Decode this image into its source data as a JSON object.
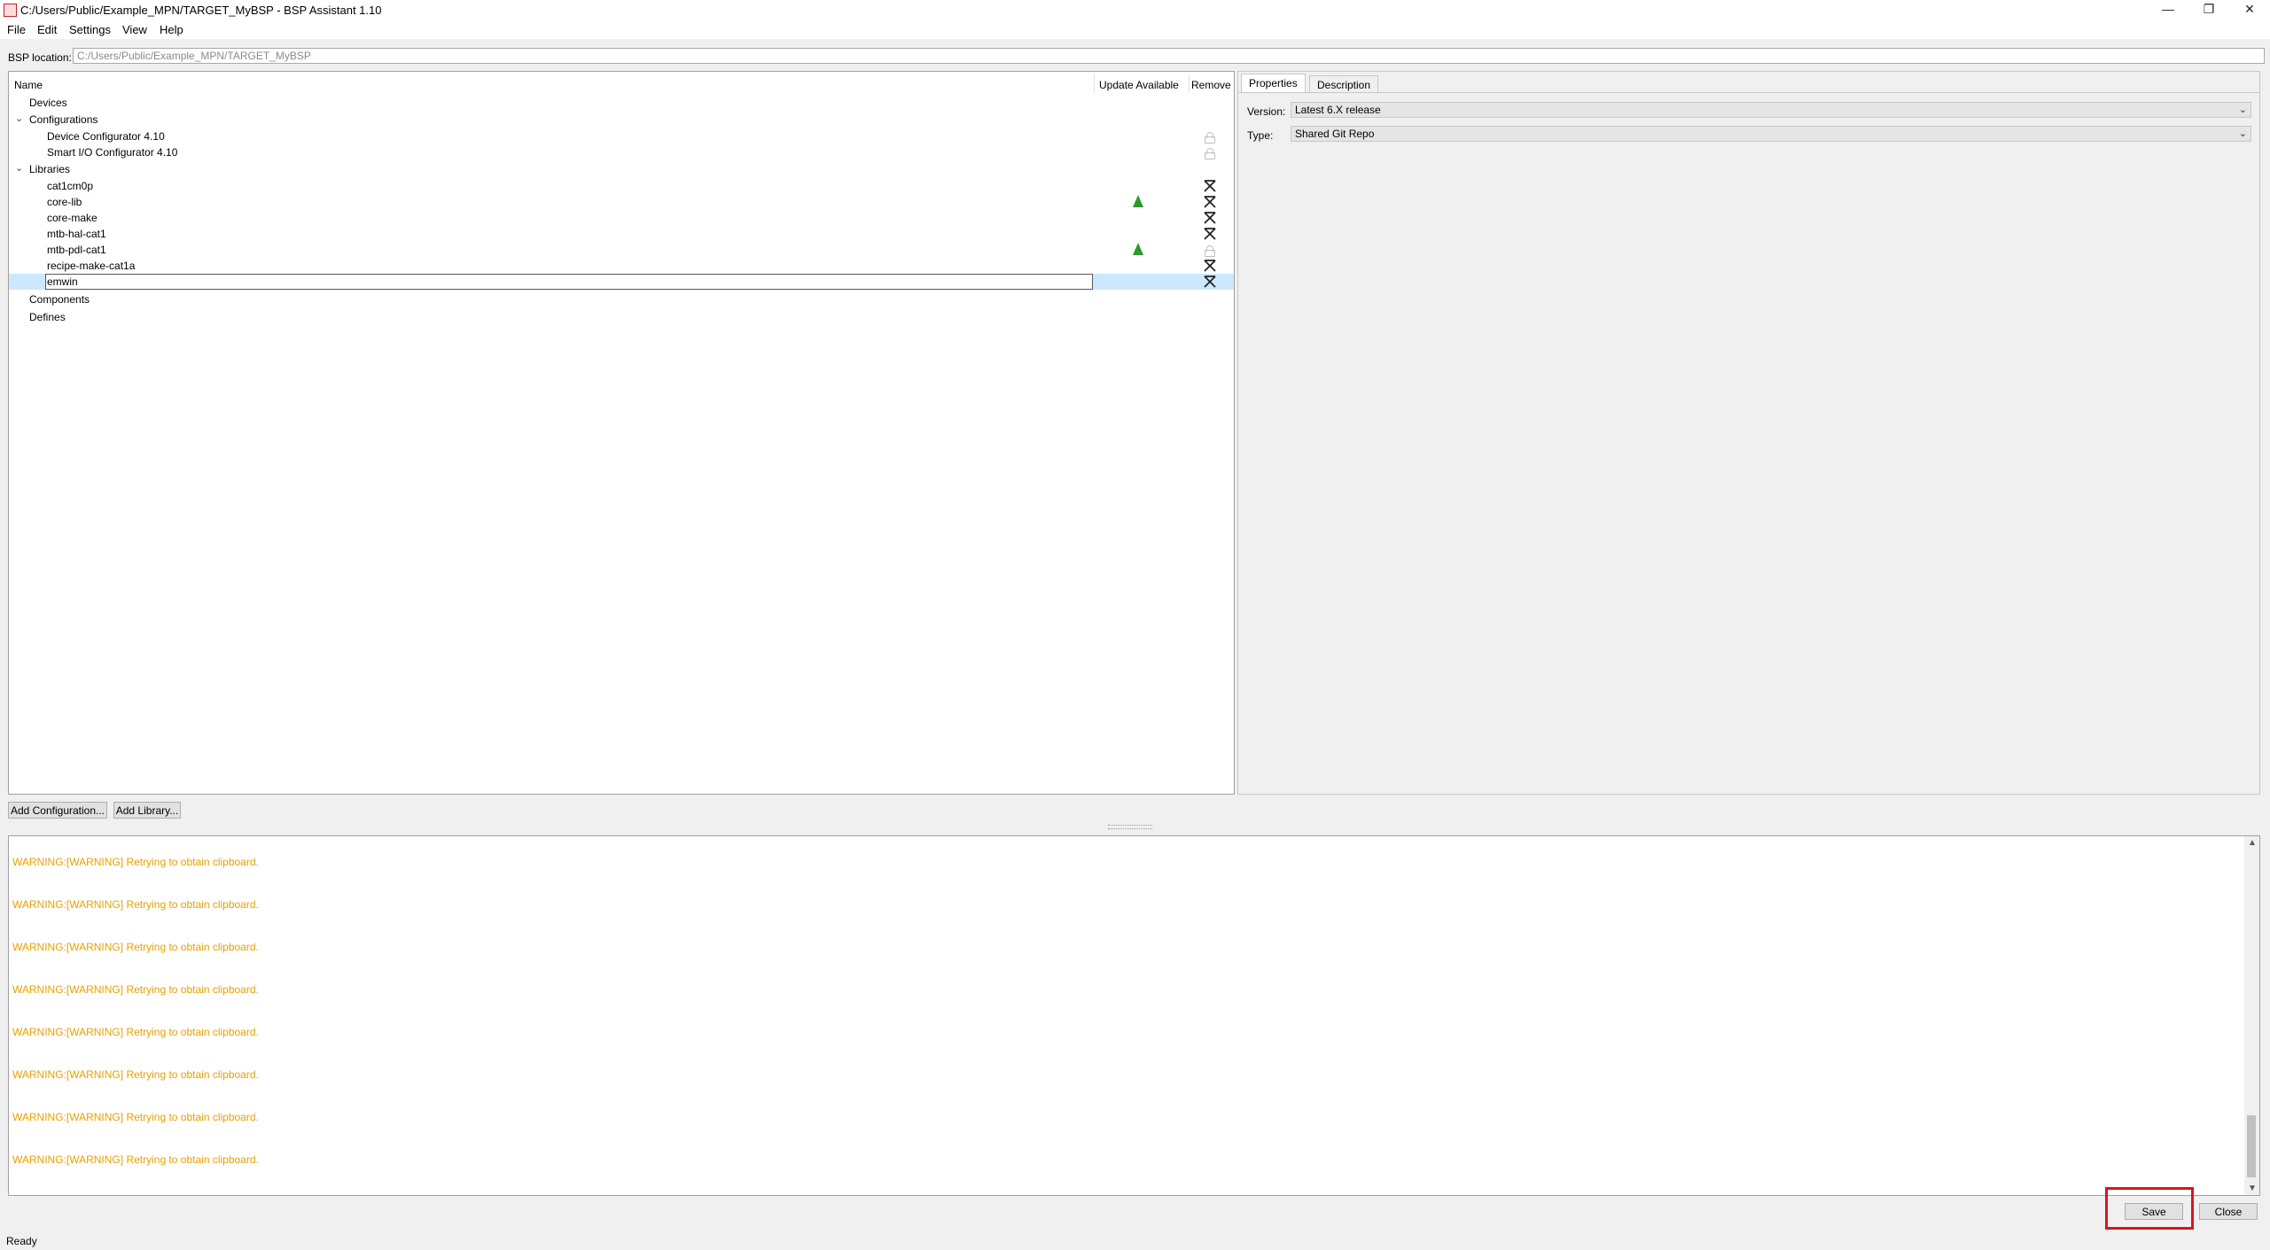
{
  "window": {
    "title": "C:/Users/Public/Example_MPN/TARGET_MyBSP - BSP Assistant 1.10",
    "minimize": "—",
    "restore": "❐",
    "close": "✕"
  },
  "menu": [
    "File",
    "Edit",
    "Settings",
    "View",
    "Help"
  ],
  "bsp_location": {
    "label": "BSP location:",
    "value": "C:/Users/Public/Example_MPN/TARGET_MyBSP"
  },
  "tree": {
    "headers": {
      "name": "Name",
      "update": "Update Available",
      "remove": "Remove"
    },
    "rows": [
      {
        "label": "Devices"
      },
      {
        "label": "Configurations"
      },
      {
        "label": "Device Configurator 4.10"
      },
      {
        "label": "Smart I/O Configurator 4.10"
      },
      {
        "label": "Libraries"
      },
      {
        "label": "cat1cm0p"
      },
      {
        "label": "core-lib"
      },
      {
        "label": "core-make"
      },
      {
        "label": "mtb-hal-cat1"
      },
      {
        "label": "mtb-pdl-cat1"
      },
      {
        "label": "recipe-make-cat1a"
      },
      {
        "label": "emwin"
      },
      {
        "label": "Components"
      },
      {
        "label": "Defines"
      }
    ]
  },
  "properties": {
    "tabs": [
      "Properties",
      "Description"
    ],
    "version_label": "Version:",
    "version_value": "Latest 6.X release",
    "type_label": "Type:",
    "type_value": "Shared Git Repo"
  },
  "buttons": {
    "add_configuration": "Add Configuration...",
    "add_library": "Add Library...",
    "save": "Save",
    "close": "Close"
  },
  "log": {
    "lines": [
      "WARNING:[WARNING] Retrying to obtain clipboard.",
      "WARNING:[WARNING] Retrying to obtain clipboard.",
      "WARNING:[WARNING] Retrying to obtain clipboard.",
      "WARNING:[WARNING] Retrying to obtain clipboard.",
      "WARNING:[WARNING] Retrying to obtain clipboard.",
      "WARNING:[WARNING] Retrying to obtain clipboard.",
      "WARNING:[WARNING] Retrying to obtain clipboard.",
      "WARNING:[WARNING] Retrying to obtain clipboard."
    ]
  },
  "status": "Ready",
  "colors": {
    "warning": "#e8a000",
    "selection": "#cce8ff",
    "update_arrow": "#2a9a2a",
    "highlight": "#d9151e"
  }
}
